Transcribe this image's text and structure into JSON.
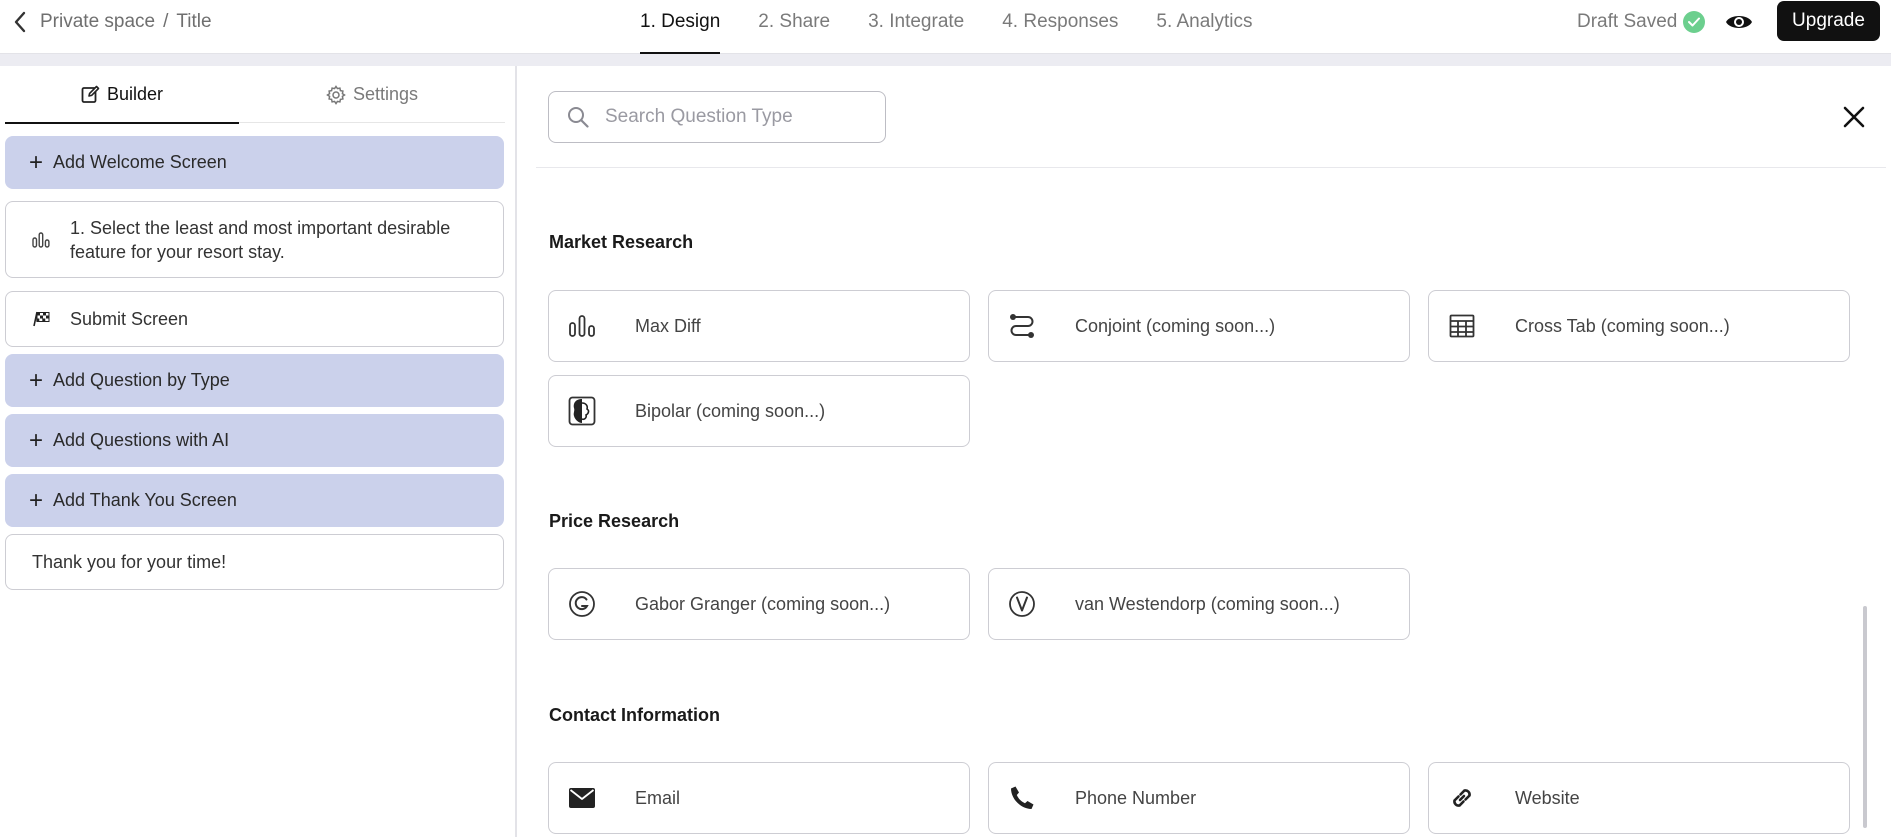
{
  "header": {
    "breadcrumb": [
      "Private space",
      "Title"
    ],
    "breadcrumb_separator": "/",
    "steps": [
      "1. Design",
      "2. Share",
      "3. Integrate",
      "4. Responses",
      "5. Analytics"
    ],
    "active_step": 0,
    "draft_status": "Draft Saved",
    "upgrade_label": "Upgrade"
  },
  "sidebar": {
    "tabs": {
      "builder": "Builder",
      "settings": "Settings"
    },
    "items": [
      {
        "kind": "add",
        "label": "Add Welcome Screen"
      },
      {
        "kind": "question",
        "icon": "bar-chart-icon",
        "label": "1. Select the least and most important desirable feature for your resort stay."
      },
      {
        "kind": "screen",
        "icon": "checkered-flag-icon",
        "label": "Submit Screen"
      },
      {
        "kind": "add",
        "label": "Add Question by Type"
      },
      {
        "kind": "add",
        "label": "Add Questions with AI"
      },
      {
        "kind": "add",
        "label": "Add Thank You Screen"
      },
      {
        "kind": "screen",
        "label": "Thank you for your time!"
      }
    ]
  },
  "picker": {
    "search_placeholder": "Search Question Type",
    "sections": [
      {
        "title": "Market Research",
        "items": [
          {
            "label": "Max Diff",
            "icon": "max-diff-icon"
          },
          {
            "label": "Conjoint (coming soon...)",
            "icon": "conjoint-icon"
          },
          {
            "label": "Cross Tab (coming soon...)",
            "icon": "table-icon"
          },
          {
            "label": "Bipolar (coming soon...)",
            "icon": "bipolar-icon"
          }
        ]
      },
      {
        "title": "Price Research",
        "items": [
          {
            "label": "Gabor Granger (coming soon...)",
            "icon": "gabor-granger-icon"
          },
          {
            "label": "van Westendorp (coming soon...)",
            "icon": "van-westendorp-icon"
          }
        ]
      },
      {
        "title": "Contact Information",
        "items": [
          {
            "label": "Email",
            "icon": "email-icon"
          },
          {
            "label": "Phone Number",
            "icon": "phone-icon"
          },
          {
            "label": "Website",
            "icon": "link-icon"
          }
        ]
      }
    ]
  },
  "colors": {
    "accent_dark": "#111111",
    "add_item_bg": "#cbd1eb",
    "saved_green": "#6ccf8e"
  }
}
